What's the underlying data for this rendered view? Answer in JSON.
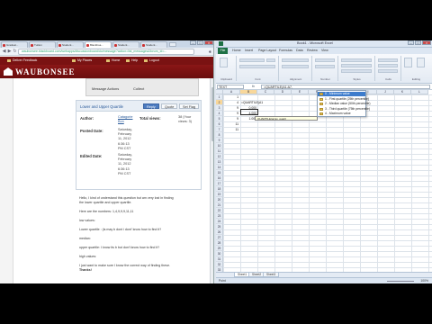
{
  "browser": {
    "tabs": [
      "Graduat...",
      "Tuition",
      "Student...",
      "Blackboa...",
      "Student...",
      "Student..."
    ],
    "active_tab_index": 3,
    "url": "waubonsee.blackboard.com/webapps/discussionboard/do/message?action=list_messages&forum_id=...",
    "lms_nav": [
      "Deliver Feedback",
      "My Places",
      "Home",
      "Help",
      "Logout"
    ],
    "brand": "WAUBONSEE",
    "actions": [
      "Message Actions",
      "Collect"
    ],
    "thread": {
      "title": "Lower and Upper Quartile",
      "buttons": [
        "Reply",
        "Quote",
        "Set Flag"
      ],
      "author_label": "Author:",
      "author_value": [
        "Catagorie",
        "Bon"
      ],
      "views_label": "Total views:",
      "views_value": [
        "38 (Your",
        "views: 3)"
      ],
      "posted_label": "Posted Date:",
      "posted_value": [
        "Saturday,",
        "February",
        "11, 2012",
        "6:36:13",
        "PM CST"
      ],
      "edited_label": "Edited Date:",
      "edited_value": [
        "Saturday,",
        "February",
        "11, 2012",
        "6:36:13",
        "PM CST"
      ]
    },
    "post": [
      "Hello, I kind of understand this question but am very lost in finding",
      "the lower quartile and upper quartile.",
      "Here are the numbers: 1,4,9,9,9,11,11",
      "low values:",
      "Lower quartile : (is may b dont i dont' know how to find it?",
      "median:",
      "upper quartile: I know its b but don't know how to find it?",
      "high values:",
      "I just want to make sure I know the correct way of finding these.",
      "Thanks!"
    ]
  },
  "excel": {
    "title": "Book1 - Microsoft Excel",
    "file_tab": "File",
    "tabs": [
      "Home",
      "Insert",
      "Page Layout",
      "Formulas",
      "Data",
      "Review",
      "View"
    ],
    "ribbon_groups": [
      "Clipboard",
      "Font",
      "Alignment",
      "Number",
      "Styles",
      "Cells",
      "Editing"
    ],
    "name_box": "TEXT",
    "fx": "fx",
    "formula": "=QUARTILE(A1:A7,",
    "columns": [
      "A",
      "B",
      "C",
      "D",
      "E",
      "F",
      "G",
      "H",
      "I",
      "J",
      "K",
      "L"
    ],
    "selected_column": "B",
    "rows": [
      "1",
      "2",
      "3",
      "4",
      "5",
      "6",
      "7",
      "8",
      "9",
      "10",
      "11",
      "12",
      "13",
      "14",
      "15",
      "16",
      "17",
      "18",
      "19",
      "20",
      "21",
      "22",
      "23",
      "24",
      "25",
      "26",
      "27",
      "28",
      "29",
      "30",
      "31",
      "32",
      "33"
    ],
    "selected_row": "2",
    "col_a_values": [
      "1",
      "4",
      "9",
      "9",
      "9",
      "11",
      "11"
    ],
    "col_b_values": [
      "",
      "=QUARTILE(A1",
      "0.000",
      "4.000",
      "1.000"
    ],
    "tooltip": "QUARTILE(array, quart)",
    "autocomplete": [
      "0 - Minimum value",
      "1 - First quartile (25th percentile)",
      "2 - Median value (50th percentile)",
      "3 - Third quartile (75th percentile)",
      "4 - Maximum value"
    ],
    "autocomplete_selected_index": 0,
    "sheet_tabs": [
      "Sheet1",
      "Sheet2",
      "Sheet3"
    ],
    "status_mode": "Point",
    "zoom": "100%"
  }
}
